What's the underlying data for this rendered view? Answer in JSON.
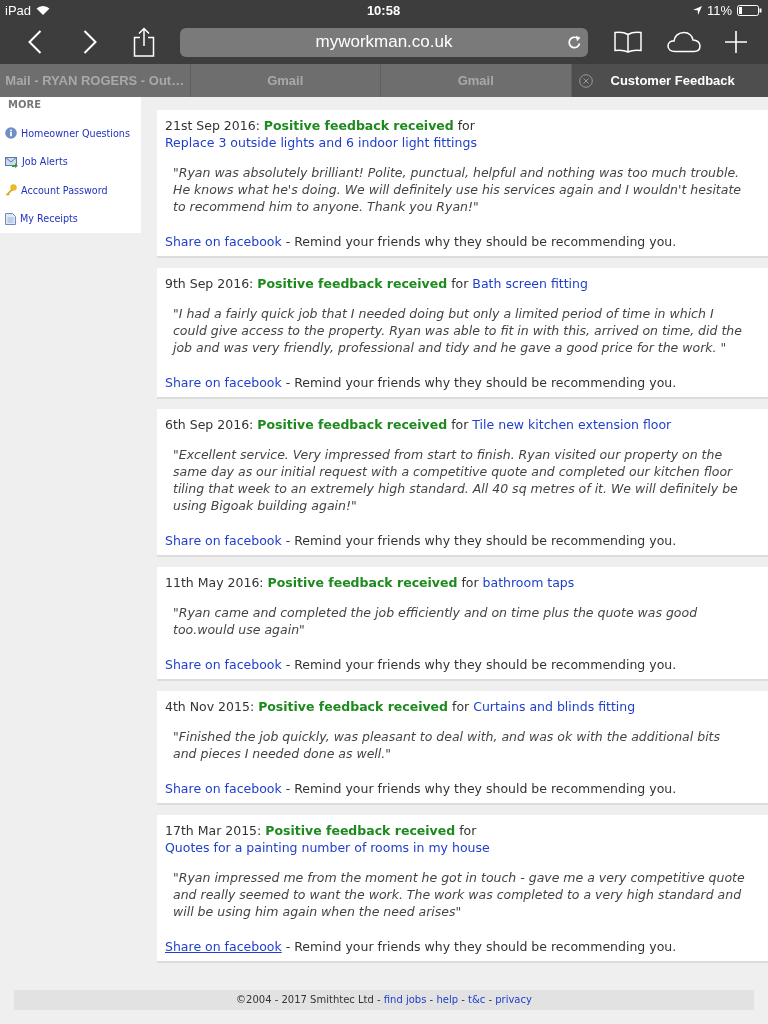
{
  "status_bar": {
    "device": "iPad",
    "time": "10:58",
    "battery": "11%"
  },
  "toolbar": {
    "url": "myworkman.co.uk"
  },
  "tabs": [
    {
      "label": "Mail - RYAN ROGERS - Out…",
      "selected": false
    },
    {
      "label": "Gmail",
      "selected": false
    },
    {
      "label": "Gmail",
      "selected": false
    },
    {
      "label": "Customer Feedback",
      "selected": true
    }
  ],
  "sidebar": {
    "heading": "MORE",
    "items": [
      {
        "label": "Homeowner Questions",
        "kind": "help"
      },
      {
        "label": "Job Alerts",
        "kind": "alerts"
      },
      {
        "label": "Account Password",
        "kind": "password"
      },
      {
        "label": "My Receipts",
        "kind": "receipts"
      }
    ]
  },
  "feedback": [
    {
      "heading": "21st Sep 2016: **Positive feedback received** for",
      "job_link": "Replace 3 outside lights and 6 indoor light fittings",
      "quote": "\"Ryan was absolutely brilliant! Polite, punctual, helpful and nothing was too much trouble. He knows what he's doing. We will definitely use his services again and I wouldn't hesitate to recommend him to anyone. Thank you Ryan!\"",
      "share_link": {
        "label": "Share on facebook",
        "underlined": false
      },
      "share_text": "- Remind your friends why they should be recommending you."
    },
    {
      "heading": "9th Sep 2016: **Positive feedback received** for",
      "job_link": "Bath screen fitting",
      "quote": "\"I had a fairly quick job that I needed doing but only a limited period of time in which I could give access to the property. Ryan was able to fit in with this, arrived on time, did the job and was very friendly, professional and tidy and he gave a good price for the work. \"",
      "share_link": {
        "label": "Share on facebook",
        "underlined": false
      },
      "share_text": "- Remind your friends why they should be recommending you."
    },
    {
      "heading": "6th Sep 2016: **Positive feedback received** for",
      "job_link": "Tile new kitchen extension floor",
      "quote": "\"Excellent service. Very impressed from start to finish. Ryan visited our property on the same day as our initial request with a competitive quote and completed our kitchen floor tiling that week to an extremely high standard. All 40 sq metres of it. We will definitely be using Bigoak building again!\"",
      "share_link": {
        "label": "Share on facebook",
        "underlined": false
      },
      "share_text": "- Remind your friends why they should be recommending you."
    },
    {
      "heading": "11th May 2016: **Positive feedback received** for",
      "job_link": "bathroom taps",
      "quote": "\"Ryan came and completed the job efficiently and on time plus the quote was good too.would use again\"",
      "share_link": {
        "label": "Share on facebook",
        "underlined": false
      },
      "share_text": "- Remind your friends why they should be recommending you."
    },
    {
      "heading": "4th Nov 2015: **Positive feedback received** for",
      "job_link": "Curtains and blinds fitting",
      "quote": "\"Finished the job quickly, was pleasant to deal with, and was ok with the additional bits and pieces I needed done as well.\"",
      "share_link": {
        "label": "Share on facebook",
        "underlined": false
      },
      "share_text": "- Remind your friends why they should be recommending you."
    },
    {
      "heading": "17th Mar 2015: **Positive feedback received** for",
      "job_link": "Quotes for a painting number of rooms in my house",
      "quote": "\"Ryan impressed me from the moment he got in touch - gave me a very competitive quote and really seemed to want the work. The work was completed to a very high standard and will be using him again when the need arises\"",
      "share_link": {
        "label": "Share on facebook",
        "underlined": true
      },
      "share_text": "- Remind your friends why they should be recommending you."
    }
  ],
  "footer": {
    "parts": [
      {
        "kind": "text",
        "text": "©2004 - 2017 Smithtec Ltd -"
      },
      {
        "kind": "link",
        "text": "find jobs"
      },
      {
        "kind": "text",
        "text": "-"
      },
      {
        "kind": "link",
        "text": "help"
      },
      {
        "kind": "text",
        "text": "-"
      },
      {
        "kind": "link",
        "text": "t&c"
      },
      {
        "kind": "text",
        "text": "-"
      },
      {
        "kind": "link",
        "text": "privacy"
      }
    ]
  }
}
